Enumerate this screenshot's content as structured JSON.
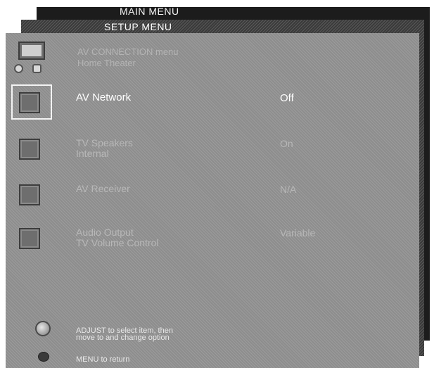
{
  "menus": {
    "main_title": "MAIN MENU",
    "setup_title": "SETUP MENU"
  },
  "header": {
    "line1": "AV CONNECTION menu",
    "line2": "Home Theater"
  },
  "items": [
    {
      "label": "AV Network",
      "label2": "",
      "value": "Off",
      "selected": true
    },
    {
      "label": "TV Speakers",
      "label2": "Internal",
      "value": "On",
      "selected": false
    },
    {
      "label": "AV Receiver",
      "label2": "",
      "value": "N/A",
      "selected": false
    },
    {
      "label": "Audio Output",
      "label2": "TV Volume Control",
      "value": "Variable",
      "selected": false
    }
  ],
  "footer": {
    "adjust_line1": "ADJUST to select item, then",
    "adjust_line2": "move to and change option",
    "menu_return": "MENU to return"
  },
  "icons": {
    "top": "tv-icon",
    "items": [
      "av-network-icon",
      "tv-speakers-icon",
      "av-receiver-icon",
      "audio-output-icon"
    ],
    "adjust": "dial-icon",
    "menu": "menu-button-icon"
  }
}
